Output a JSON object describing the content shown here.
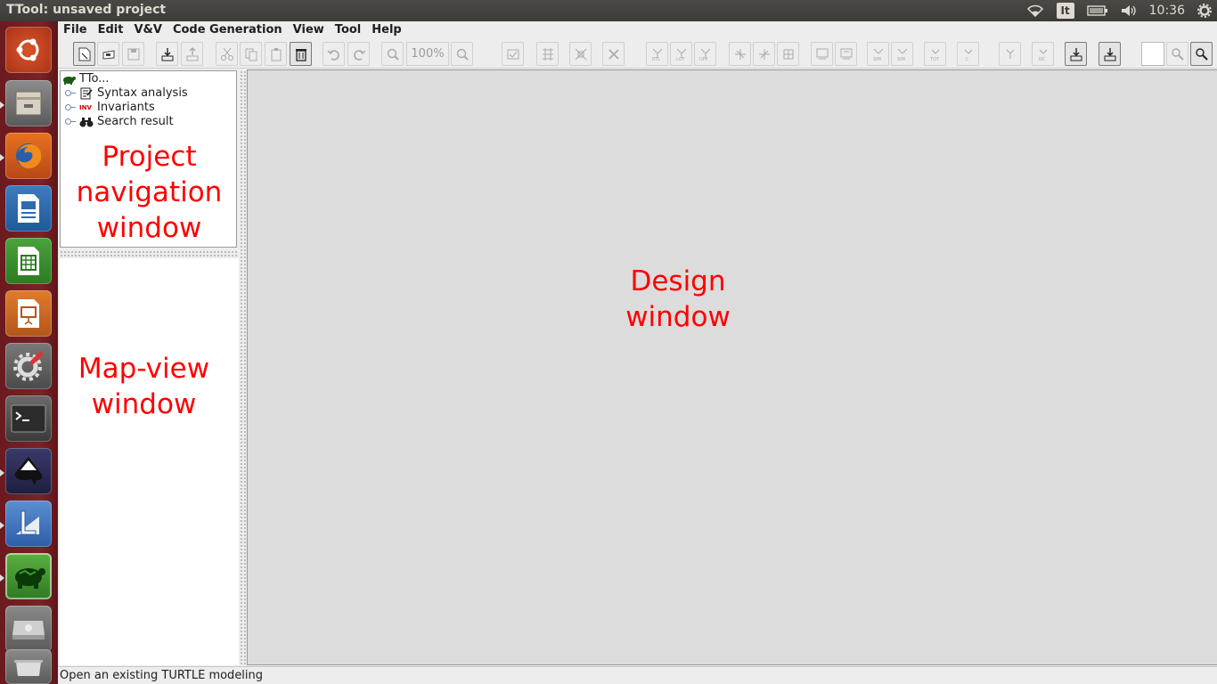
{
  "window_title": "TTool: unsaved project",
  "top_panel": {
    "keyboard_layout": "It",
    "clock": "10:36"
  },
  "launcher": {
    "items": [
      "dash-icon",
      "files-icon",
      "firefox-icon",
      "writer-icon",
      "calc-icon",
      "impress-icon",
      "system-settings-icon",
      "terminal-icon",
      "inkscape-icon",
      "text-editor-icon",
      "ttool-icon",
      "disk-icon",
      "trash-icon"
    ]
  },
  "menubar": {
    "items": [
      "File",
      "Edit",
      "V&V",
      "Code Generation",
      "View",
      "Tool",
      "Help"
    ]
  },
  "toolbar": {
    "zoom_label": "100%"
  },
  "project_nav": {
    "root_label": "TTo...",
    "items": [
      "Syntax analysis",
      "Invariants",
      "Search result"
    ],
    "invariants_icon_text": "INV"
  },
  "annotations": {
    "project_nav": "Project navigation window",
    "map_view": "Map-view window",
    "design": "Design window"
  },
  "status_bar": {
    "text": "Open an existing TURTLE modeling"
  },
  "colors": {
    "annotation": "#ff0000",
    "launcher": "#7a2226",
    "top_panel": "#3c3b37"
  }
}
